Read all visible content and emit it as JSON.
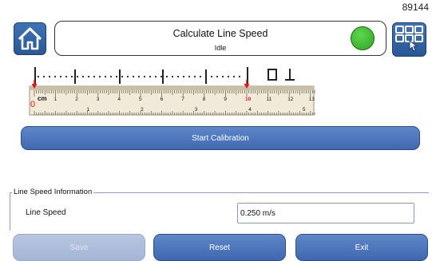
{
  "code_number": "89144",
  "header": {
    "title": "Calculate Line Speed",
    "status": "Idle",
    "led_color": "#39b52a"
  },
  "ruler": {
    "unit": "cm",
    "major_labels": [
      "0",
      "1",
      "2",
      "3",
      "4",
      "5",
      "6",
      "7",
      "8",
      "9",
      "10",
      "11",
      "12",
      "13"
    ],
    "minor_labels": [
      "1",
      "2",
      "3",
      "4",
      "5"
    ],
    "marker_color": "#e01818",
    "marker_values": [
      0,
      10
    ],
    "dot_matrix_label": "01"
  },
  "buttons": {
    "start_calibration": "Start Calibration",
    "save": "Save",
    "reset": "Reset",
    "exit": "Exit"
  },
  "line_speed": {
    "legend": "Line Speed Information",
    "label": "Line Speed",
    "value": "0.250 m/s"
  },
  "icons": {
    "home": "home-icon",
    "menu": "menu-grid-hand-icon",
    "status": "status-led-icon"
  }
}
